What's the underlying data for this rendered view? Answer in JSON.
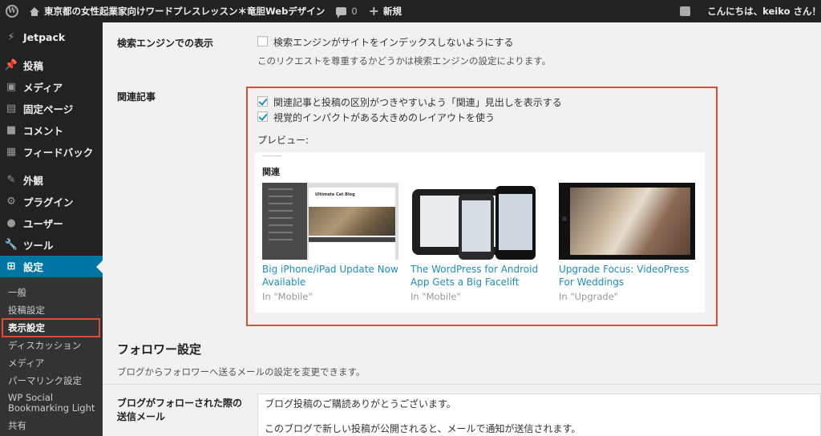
{
  "admin_bar": {
    "site_title": "東京都の女性起業家向けワードプレスレッスン＊竜胆Webデザイン",
    "comments_count": "0",
    "new_label": "新規",
    "greeting": "こんにちは、keiko さん！"
  },
  "sidebar": {
    "items": [
      {
        "label": "Jetpack",
        "icon": "jetpack-icon"
      },
      {
        "label": "投稿",
        "icon": "pin-icon"
      },
      {
        "label": "メディア",
        "icon": "media-icon"
      },
      {
        "label": "固定ページ",
        "icon": "page-icon"
      },
      {
        "label": "コメント",
        "icon": "comment-icon"
      },
      {
        "label": "フィードバック",
        "icon": "feedback-icon"
      },
      {
        "label": "外観",
        "icon": "brush-icon"
      },
      {
        "label": "プラグイン",
        "icon": "plugin-icon"
      },
      {
        "label": "ユーザー",
        "icon": "user-icon"
      },
      {
        "label": "ツール",
        "icon": "wrench-icon"
      },
      {
        "label": "設定",
        "icon": "settings-icon"
      }
    ],
    "submenu": [
      "一般",
      "投稿設定",
      "表示設定",
      "ディスカッション",
      "メディア",
      "パーマリンク設定",
      "WP Social Bookmarking Light",
      "共有"
    ],
    "active_color": "#0074a2"
  },
  "search_engine": {
    "label": "検索エンジンでの表示",
    "option": "検索エンジンがサイトをインデックスしないようにする",
    "checked": false,
    "description": "このリクエストを尊重するかどうかは検索エンジンの設定によります。"
  },
  "related": {
    "label": "関連記事",
    "option1": "関連記事と投稿の区別がつきやすいよう「関連」見出しを表示する",
    "option1_checked": true,
    "option2": "視覚的インパクトがある大きめのレイアウトを使う",
    "option2_checked": true,
    "preview_label": "プレビュー:",
    "preview_heading": "関連",
    "thumb1_title": "Ultimate Cat Blog",
    "posts": [
      {
        "title": "Big iPhone/iPad Update Now Available",
        "category": "In \"Mobile\""
      },
      {
        "title": "The WordPress for Android App Gets a Big Facelift",
        "category": "In \"Mobile\""
      },
      {
        "title": "Upgrade Focus: VideoPress For Weddings",
        "category": "In \"Upgrade\""
      }
    ]
  },
  "followers": {
    "heading": "フォロワー設定",
    "description": "ブログからフォロワーへ送るメールの設定を変更できます。",
    "mail_label": "ブログがフォローされた際の送信メール",
    "mail_line1": "ブログ投稿のご購読ありがとうございます。",
    "mail_line2": "このブログで新しい投稿が公開されると、メールで通知が送信されます。"
  }
}
